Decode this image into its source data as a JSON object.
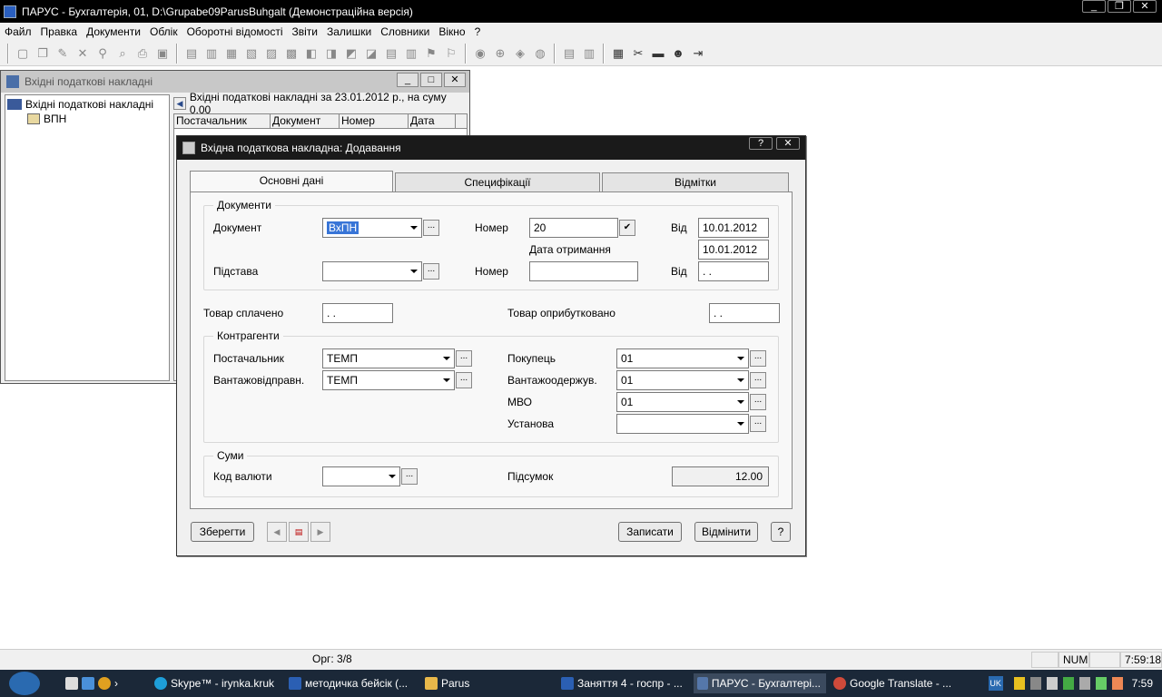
{
  "app": {
    "title": "ПАРУС - Бухгалтерія, 01, D:\\Grupabe09ParusBuhgalt (Демонстраційна версія)",
    "controls": [
      "_",
      "❐",
      "✕"
    ]
  },
  "menu": [
    "Файл",
    "Правка",
    "Документи",
    "Облік",
    "Оборотні відомості",
    "Звіти",
    "Залишки",
    "Словники",
    "Вікно",
    "?"
  ],
  "child_window": {
    "title": "Вхідні податкові накладні",
    "tree": {
      "root": "Вхідні податкові накладні",
      "child": "ВПН"
    },
    "list_header": "Вхідні податкові накладні за 23.01.2012 р., на суму 0.00",
    "columns": [
      "Постачальник",
      "Документ",
      "Номер",
      "Дата"
    ]
  },
  "dialog": {
    "title": "Вхідна податкова накладна: Додавання",
    "help_btn": "?",
    "close_btn": "✕",
    "tabs": [
      "Основні дані",
      "Специфікації",
      "Відмітки"
    ],
    "documents": {
      "group_label": "Документи",
      "document_label": "Документ",
      "document_value": "ВхПН",
      "number_label": "Номер",
      "number_value": "20",
      "from_label": "Від",
      "from_value": "10.01.2012",
      "received_label": "Дата отримання",
      "received_value": "10.01.2012",
      "basis_label": "Підстава",
      "basis_value": "",
      "basis_number_label": "Номер",
      "basis_number_value": "",
      "basis_from_label": "Від",
      "basis_from_value": " .  ."
    },
    "paid_label": "Товар сплачено",
    "paid_value": " .  .",
    "posted_label": "Товар оприбутковано",
    "posted_value": " .  .",
    "contractors": {
      "group_label": "Контрагенти",
      "supplier_label": "Постачальник",
      "supplier_value": "ТЕМП",
      "shipper_label": "Вантажовідправн.",
      "shipper_value": "ТЕМП",
      "buyer_label": "Покупець",
      "buyer_value": "01",
      "consignee_label": "Вантажоодержув.",
      "consignee_value": "01",
      "mvo_label": "МВО",
      "mvo_value": "01",
      "institution_label": "Установа",
      "institution_value": ""
    },
    "sums": {
      "group_label": "Суми",
      "currency_label": "Код валюти",
      "currency_value": "",
      "total_label": "Підсумок",
      "total_value": "12.00"
    },
    "buttons": {
      "save": "Зберегти",
      "write": "Записати",
      "cancel": "Відмінити",
      "help": "?"
    }
  },
  "statusbar": {
    "record": "Орг: 3/8",
    "num": "NUM",
    "time": "7:59:18"
  },
  "taskbar": {
    "items": [
      {
        "label": "Skype™ - irynka.kruk",
        "color": "#1e9ed8"
      },
      {
        "label": "методичка бейсік (...",
        "color": "#2b5fb3"
      },
      {
        "label": "Parus",
        "color": "#e8b84a"
      },
      {
        "label": "Заняття 4 - госпр - ...",
        "color": "#2b5fb3"
      },
      {
        "label": "ПАРУС - Бухгалтері...",
        "color": "#5577aa"
      },
      {
        "label": "Google Translate - ...",
        "color": "#d04a3a"
      }
    ],
    "lang": "UK",
    "clock": "7:59"
  }
}
